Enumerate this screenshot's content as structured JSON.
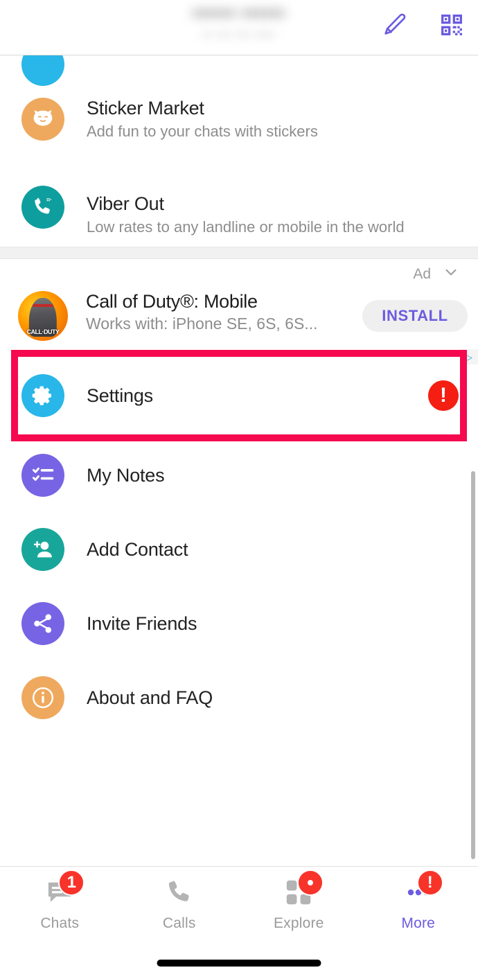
{
  "header": {
    "profile_name_redacted": "•••••• ••••••",
    "profile_sub_redacted": "•• ••• ••• ••••",
    "edit_icon": "pencil-icon",
    "qr_icon": "qr-code-icon",
    "accent_purple": "#6b5ce0"
  },
  "partial_row": {
    "title": "",
    "icon": "blue-circle-icon"
  },
  "menu": {
    "items": [
      {
        "title": "Sticker Market",
        "subtitle": "Add fun to your chats with stickers",
        "icon": "sticker-cat-icon",
        "icon_color": "#efa95e"
      },
      {
        "title": "Viber Out",
        "subtitle": "Low rates to any landline or mobile in the world",
        "icon": "phone-out-icon",
        "icon_color": "#0f9e9e"
      }
    ]
  },
  "ad": {
    "label": "Ad",
    "chevron_icon": "chevron-down-icon",
    "title": "Call of Duty®: Mobile",
    "subtitle": "Works with: iPhone SE, 6S, 6S...",
    "install_label": "INSTALL",
    "thumb_text": "CALL·DUTY",
    "thumb_icon": "call-of-duty-thumbnail",
    "choices_icon": "ad-choices-icon"
  },
  "actions": {
    "items": [
      {
        "title": "Settings",
        "icon": "gear-icon",
        "icon_color": "#29b6e8",
        "badge": "!",
        "badge_color": "#f41e13",
        "highlighted": true,
        "highlight_color": "#f5094f"
      },
      {
        "title": "My Notes",
        "icon": "checklist-icon",
        "icon_color": "#7764e4",
        "badge": null
      },
      {
        "title": "Add Contact",
        "icon": "add-person-icon",
        "icon_color": "#19a69a",
        "badge": null
      },
      {
        "title": "Invite Friends",
        "icon": "share-icon",
        "icon_color": "#7764e4",
        "badge": null
      },
      {
        "title": "About and FAQ",
        "icon": "info-icon",
        "icon_color": "#efa95e",
        "badge": null
      }
    ]
  },
  "tabbar": {
    "tabs": [
      {
        "label": "Chats",
        "icon": "chat-bubble-icon",
        "badge": "1",
        "active": false
      },
      {
        "label": "Calls",
        "icon": "phone-icon",
        "badge": null,
        "active": false
      },
      {
        "label": "Explore",
        "icon": "explore-grid-icon",
        "badge": "•",
        "active": false
      },
      {
        "label": "More",
        "icon": "more-dots-icon",
        "badge": "!",
        "active": true
      }
    ]
  }
}
